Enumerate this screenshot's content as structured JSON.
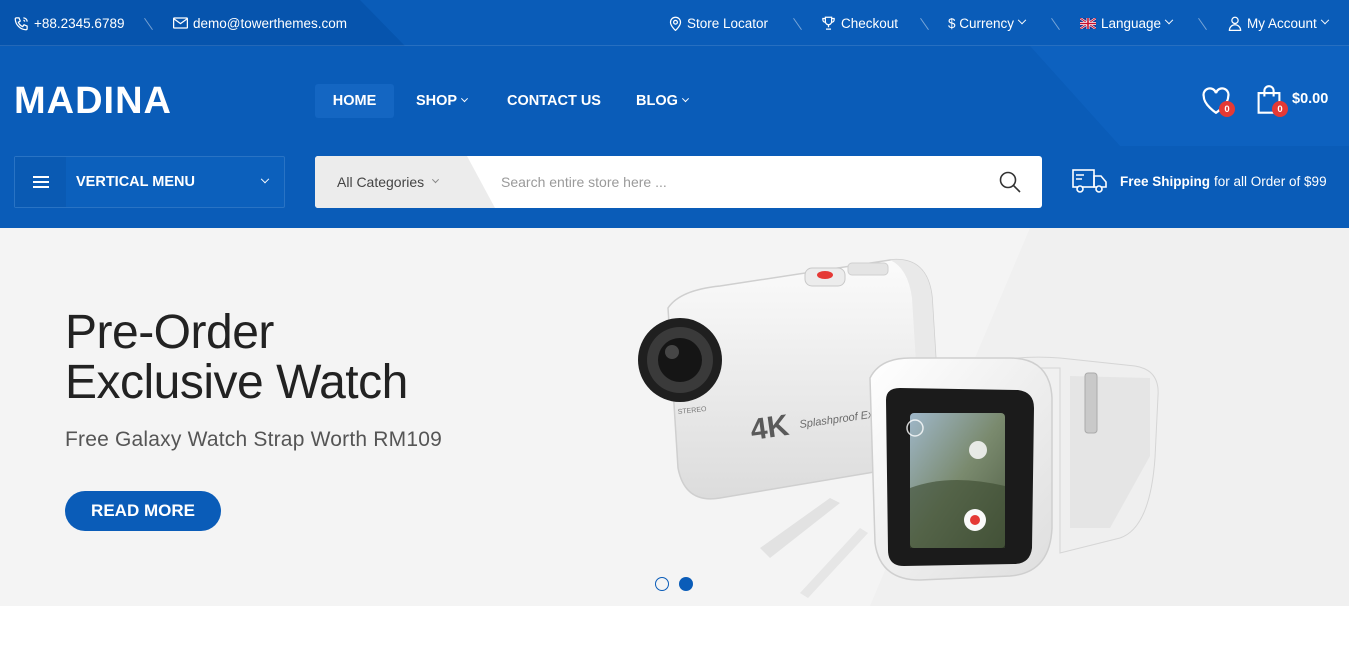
{
  "topbar": {
    "phone": "+88.2345.6789",
    "email": "demo@towerthemes.com",
    "store_locator": "Store Locator",
    "checkout": "Checkout",
    "currency": "$ Currency",
    "language": "Language",
    "my_account": "My Account"
  },
  "logo": "MADINA",
  "nav": {
    "home": "HOME",
    "shop": "SHOP",
    "contact": "CONTACT US",
    "blog": "BLOG"
  },
  "wishlist_count": "0",
  "cart": {
    "count": "0",
    "total": "$0.00"
  },
  "vertical_menu": "VERTICAL MENU",
  "search": {
    "category": "All Categories",
    "placeholder": "Search entire store here ..."
  },
  "shipping": {
    "strong": "Free Shipping",
    "rest": "for all Order of $99"
  },
  "hero": {
    "title_line1": "Pre-Order",
    "title_line2": "Exclusive Watch",
    "subtitle": "Free Galaxy Watch Strap Worth RM109",
    "button": "READ MORE",
    "camera_label_4k": "4K",
    "camera_label_text": "Splashproof Ex",
    "stereo_label": "STEREO",
    "slides": 2,
    "active_slide": 2
  },
  "colors": {
    "brand_blue": "#0a5cb8",
    "badge_red": "#e53935",
    "hero_bg": "#f4f4f4"
  },
  "icons": [
    "phone-icon",
    "mail-icon",
    "location-pin-icon",
    "trophy-icon",
    "flag-icon",
    "user-icon",
    "heart-icon",
    "shopping-bag-icon",
    "hamburger-icon",
    "search-icon",
    "truck-icon"
  ]
}
